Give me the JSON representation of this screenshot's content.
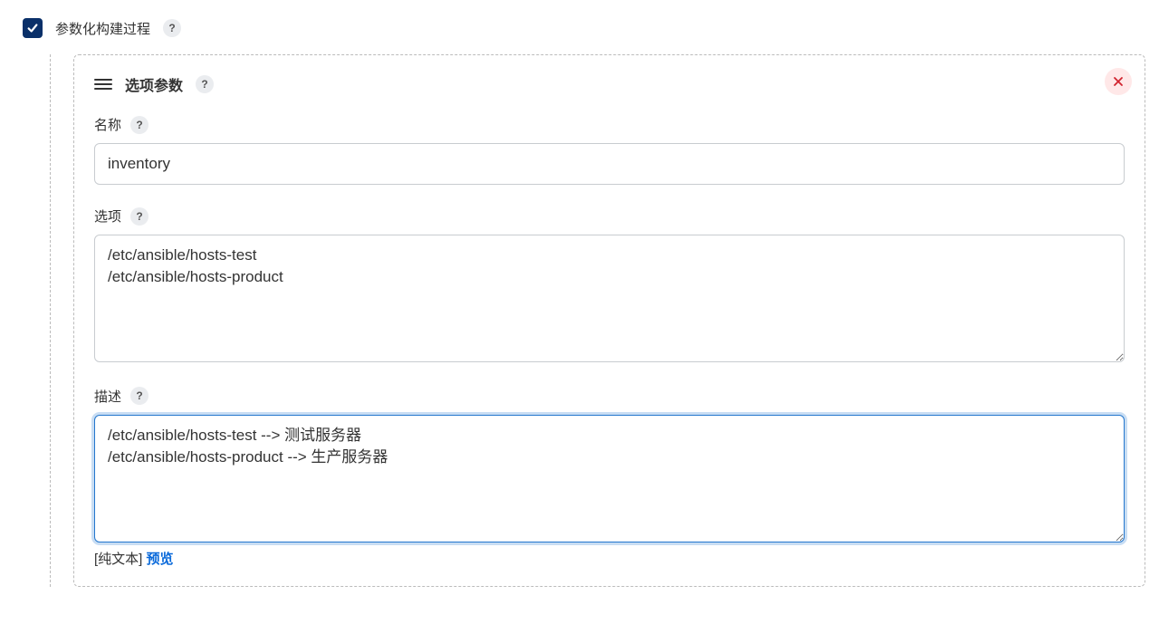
{
  "top": {
    "checkbox_label": "参数化构建过程"
  },
  "param": {
    "title": "选项参数",
    "name_label": "名称",
    "name_value": "inventory",
    "options_label": "选项",
    "options_value": "/etc/ansible/hosts-test\n/etc/ansible/hosts-product",
    "desc_label": "描述",
    "desc_value": "/etc/ansible/hosts-test --> 测试服务器\n/etc/ansible/hosts-product --> 生产服务器",
    "desc_footer_prefix": "[纯文本] ",
    "desc_footer_link": "预览"
  },
  "help_glyph": "?"
}
